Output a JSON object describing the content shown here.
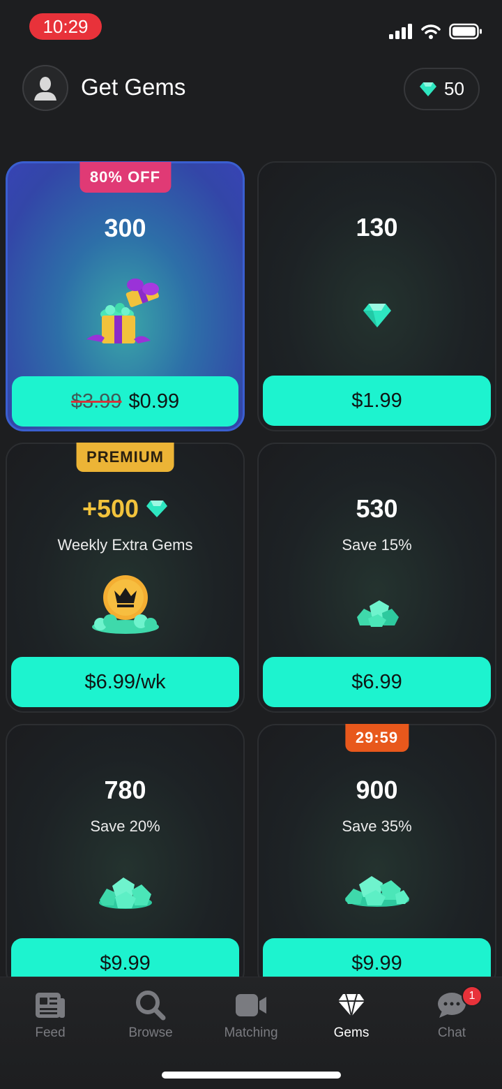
{
  "status_bar": {
    "time": "10:29"
  },
  "header": {
    "title": "Get Gems",
    "gem_balance": "50"
  },
  "offers": [
    {
      "badge": "80% OFF",
      "amount": "300",
      "original_price": "$3.99",
      "price": "$0.99"
    },
    {
      "amount": "130",
      "price": "$1.99"
    },
    {
      "badge": "PREMIUM",
      "amount": "+500",
      "subtext": "Weekly Extra Gems",
      "price": "$6.99/wk"
    },
    {
      "amount": "530",
      "subtext": "Save 15%",
      "price": "$6.99"
    },
    {
      "amount": "780",
      "subtext": "Save 20%",
      "price": "$9.99"
    },
    {
      "badge": "29:59",
      "amount": "900",
      "subtext": "Save 35%",
      "price": "$9.99"
    }
  ],
  "tabs": [
    {
      "label": "Feed",
      "icon": "newspaper-icon"
    },
    {
      "label": "Browse",
      "icon": "search-icon"
    },
    {
      "label": "Matching",
      "icon": "video-camera-icon"
    },
    {
      "label": "Gems",
      "icon": "diamond-icon",
      "active": true
    },
    {
      "label": "Chat",
      "icon": "chat-bubble-icon",
      "badge": "1"
    }
  ],
  "colors": {
    "accent": "#1df3cf",
    "gem": "#2ee6c0",
    "premium": "#ecb436",
    "discount": "#e03a75",
    "timer": "#e8581c",
    "notification": "#e8323a"
  }
}
